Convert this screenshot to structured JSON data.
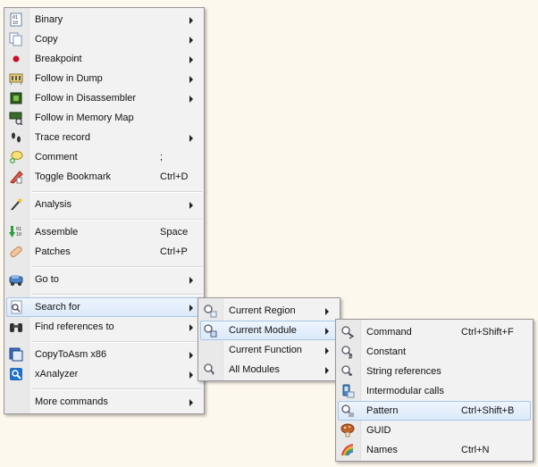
{
  "main_menu": {
    "items": [
      {
        "label": "Binary",
        "shortcut": "",
        "submenu": true,
        "icon": "binary-icon"
      },
      {
        "label": "Copy",
        "shortcut": "",
        "submenu": true,
        "icon": "copy-icon"
      },
      {
        "label": "Breakpoint",
        "shortcut": "",
        "submenu": true,
        "icon": "breakpoint-icon"
      },
      {
        "label": "Follow in Dump",
        "shortcut": "",
        "submenu": true,
        "icon": "dump-icon"
      },
      {
        "label": "Follow in Disassembler",
        "shortcut": "",
        "submenu": true,
        "icon": "cpu-icon"
      },
      {
        "label": "Follow in Memory Map",
        "shortcut": "",
        "submenu": false,
        "icon": "memory-map-icon"
      },
      {
        "label": "Trace record",
        "shortcut": "",
        "submenu": true,
        "icon": "footprints-icon"
      },
      {
        "label": "Comment",
        "shortcut": ";",
        "submenu": false,
        "icon": "comment-icon"
      },
      {
        "label": "Toggle Bookmark",
        "shortcut": "Ctrl+D",
        "submenu": false,
        "icon": "bookmark-icon"
      },
      {
        "label": "Analysis",
        "shortcut": "",
        "submenu": true,
        "icon": "wand-icon"
      },
      {
        "label": "Assemble",
        "shortcut": "Space",
        "submenu": false,
        "icon": "assemble-icon"
      },
      {
        "label": "Patches",
        "shortcut": "Ctrl+P",
        "submenu": false,
        "icon": "patch-icon"
      },
      {
        "label": "Go to",
        "shortcut": "",
        "submenu": true,
        "icon": "goto-icon"
      },
      {
        "label": "Search for",
        "shortcut": "",
        "submenu": true,
        "icon": "search-icon"
      },
      {
        "label": "Find references to",
        "shortcut": "",
        "submenu": true,
        "icon": "binoculars-icon"
      },
      {
        "label": "CopyToAsm x86",
        "shortcut": "",
        "submenu": true,
        "icon": "copytoasm-icon"
      },
      {
        "label": "xAnalyzer",
        "shortcut": "",
        "submenu": true,
        "icon": "xanalyzer-icon"
      },
      {
        "label": "More commands",
        "shortcut": "",
        "submenu": true,
        "icon": ""
      }
    ]
  },
  "search_submenu": {
    "items": [
      {
        "label": "Current Region",
        "submenu": true,
        "icon": "search-region-icon"
      },
      {
        "label": "Current Module",
        "submenu": true,
        "icon": "search-module-icon"
      },
      {
        "label": "Current Function",
        "submenu": true,
        "icon": ""
      },
      {
        "label": "All Modules",
        "submenu": true,
        "icon": "search-all-icon"
      }
    ]
  },
  "module_submenu": {
    "items": [
      {
        "label": "Command",
        "shortcut": "Ctrl+Shift+F",
        "icon": "search-command-icon"
      },
      {
        "label": "Constant",
        "shortcut": "",
        "icon": "search-constant-icon"
      },
      {
        "label": "String references",
        "shortcut": "",
        "icon": "search-string-icon"
      },
      {
        "label": "Intermodular calls",
        "shortcut": "",
        "icon": "intermodular-icon"
      },
      {
        "label": "Pattern",
        "shortcut": "Ctrl+Shift+B",
        "icon": "search-pattern-icon"
      },
      {
        "label": "GUID",
        "shortcut": "",
        "icon": "guid-icon"
      },
      {
        "label": "Names",
        "shortcut": "Ctrl+N",
        "icon": "names-icon"
      }
    ]
  },
  "colors": {
    "highlight": "#dbe9f9",
    "highlight_border": "#a7c6ea",
    "menu_bg": "#f2f2f2"
  }
}
